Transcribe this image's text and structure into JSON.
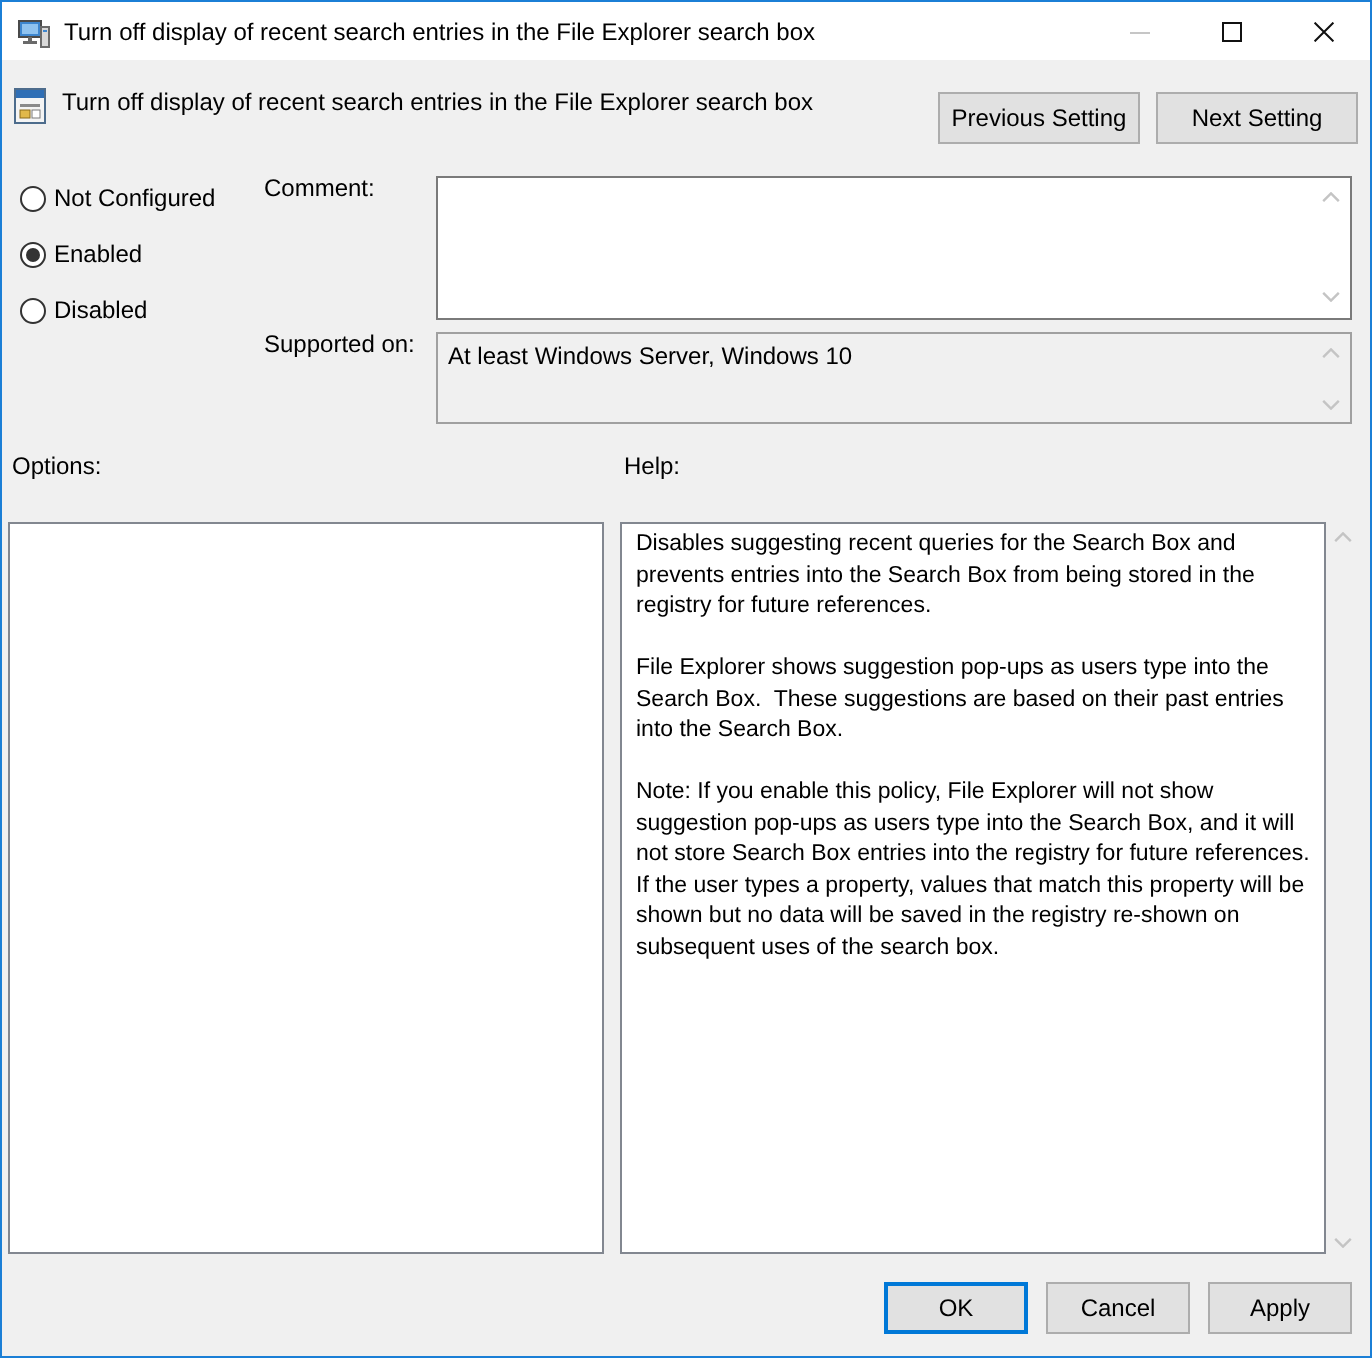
{
  "window": {
    "title": "Turn off display of recent search entries in the File Explorer search box",
    "controls": [
      {
        "kind": "minimize",
        "disabled": true
      },
      {
        "kind": "maximize",
        "disabled": false
      },
      {
        "kind": "close",
        "disabled": false
      }
    ]
  },
  "setting": {
    "title": "Turn off display of recent search entries in the File Explorer search box",
    "buttons": [
      "Previous Setting",
      "Next Setting"
    ]
  },
  "state_options": [
    {
      "label": "Not Configured",
      "selected": false
    },
    {
      "label": "Enabled",
      "selected": true
    },
    {
      "label": "Disabled",
      "selected": false
    }
  ],
  "comment": {
    "label": "Comment:"
  },
  "supported_on": {
    "label": "Supported on:",
    "value": "At least Windows Server, Windows 10"
  },
  "options": {
    "label": "Options:"
  },
  "help": {
    "label": "Help:",
    "paragraphs": [
      "Disables suggesting recent queries for the Search Box and prevents entries into the Search Box from being stored in the registry for future references.",
      "File Explorer shows suggestion pop-ups as users type into the Search Box.  These suggestions are based on their past entries into the Search Box.",
      "Note: If you enable this policy, File Explorer will not show suggestion pop-ups as users type into the Search Box, and it will not store Search Box entries into the registry for future references.  If the user types a property, values that match this property will be shown but no data will be saved in the registry re-shown on subsequent uses of the search box."
    ]
  },
  "buttons": [
    {
      "label": "OK",
      "default": true
    },
    {
      "label": "Cancel",
      "default": false
    },
    {
      "label": "Apply",
      "default": false
    }
  ]
}
